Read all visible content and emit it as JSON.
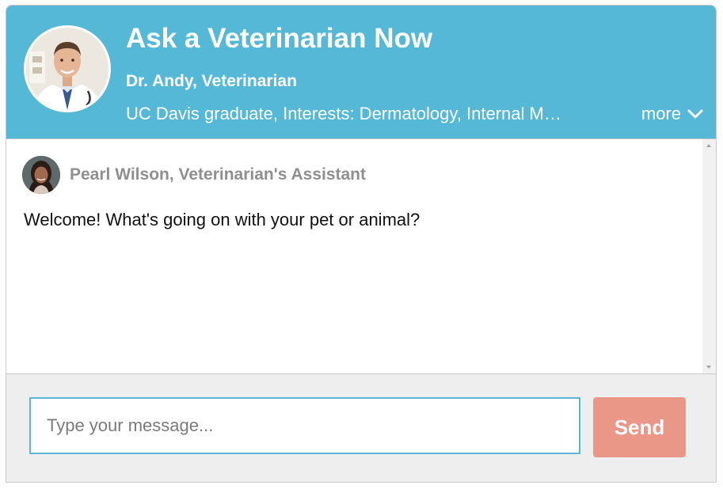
{
  "header": {
    "title": "Ask a Veterinarian Now",
    "expert_name": "Dr. Andy, Veterinarian",
    "bio": "UC Davis graduate, Interests: Dermatology, Internal Medicine",
    "more_label": "more",
    "background_color": "#54b8d6"
  },
  "chat": {
    "messages": [
      {
        "sender": "Pearl Wilson, Veterinarian's Assistant",
        "text": "Welcome! What's going on with your pet or animal?"
      }
    ]
  },
  "composer": {
    "placeholder": "Type your message...",
    "value": "",
    "send_label": "Send",
    "send_color": "#ea9787"
  }
}
